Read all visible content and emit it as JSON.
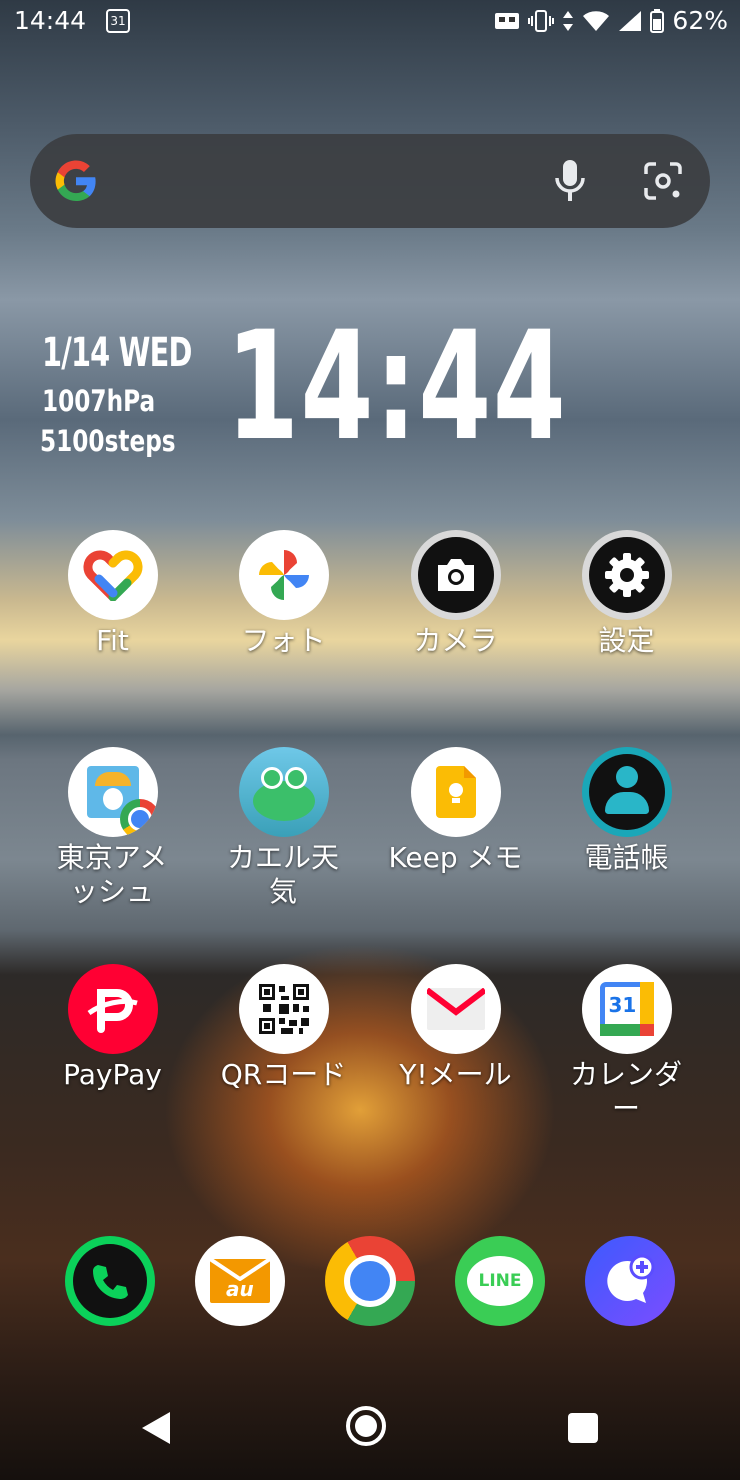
{
  "status": {
    "time": "14:44",
    "calendar_badge": "31",
    "battery": "62%"
  },
  "search": {
    "logo": "G",
    "mic_icon": "mic-icon",
    "lens_icon": "lens-icon"
  },
  "widget": {
    "date": "1/14 WED",
    "pressure": "1007hPa",
    "steps": "5100steps",
    "clock": "14:44"
  },
  "apps": {
    "row1": [
      "Fit",
      "フォト",
      "カメラ",
      "設定"
    ],
    "row2": [
      "東京アメッシュ",
      "カエル天気",
      "Keep メモ",
      "電話帳"
    ],
    "row3": [
      "PayPay",
      "QRコード",
      "Y!メール",
      "カレンダー"
    ]
  },
  "icon_texts": {
    "calendar": "31",
    "line": "LINE",
    "au": "au"
  },
  "colors": {
    "google_blue": "#4285F4",
    "google_red": "#EA4335",
    "google_yellow": "#FBBC05",
    "google_green": "#34A853",
    "line_green": "#3ACD55",
    "paypay_red": "#FF0033"
  }
}
